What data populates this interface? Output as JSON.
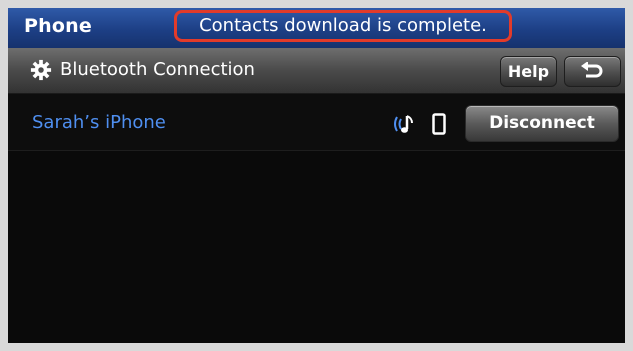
{
  "topbar": {
    "app_title": "Phone",
    "notice": "Contacts download is complete."
  },
  "header": {
    "icon": "gear-icon",
    "title": "Bluetooth Connection",
    "help_label": "Help",
    "back_icon": "back-arrow-icon"
  },
  "devices": [
    {
      "name": "Sarah’s iPhone",
      "audio_icon": "bluetooth-audio-icon",
      "phone_icon": "phone-icon",
      "action_label": "Disconnect"
    }
  ],
  "colors": {
    "topbar": "#1d3f85",
    "notice_border": "#e23b2a",
    "device_name": "#4f8ff0"
  }
}
